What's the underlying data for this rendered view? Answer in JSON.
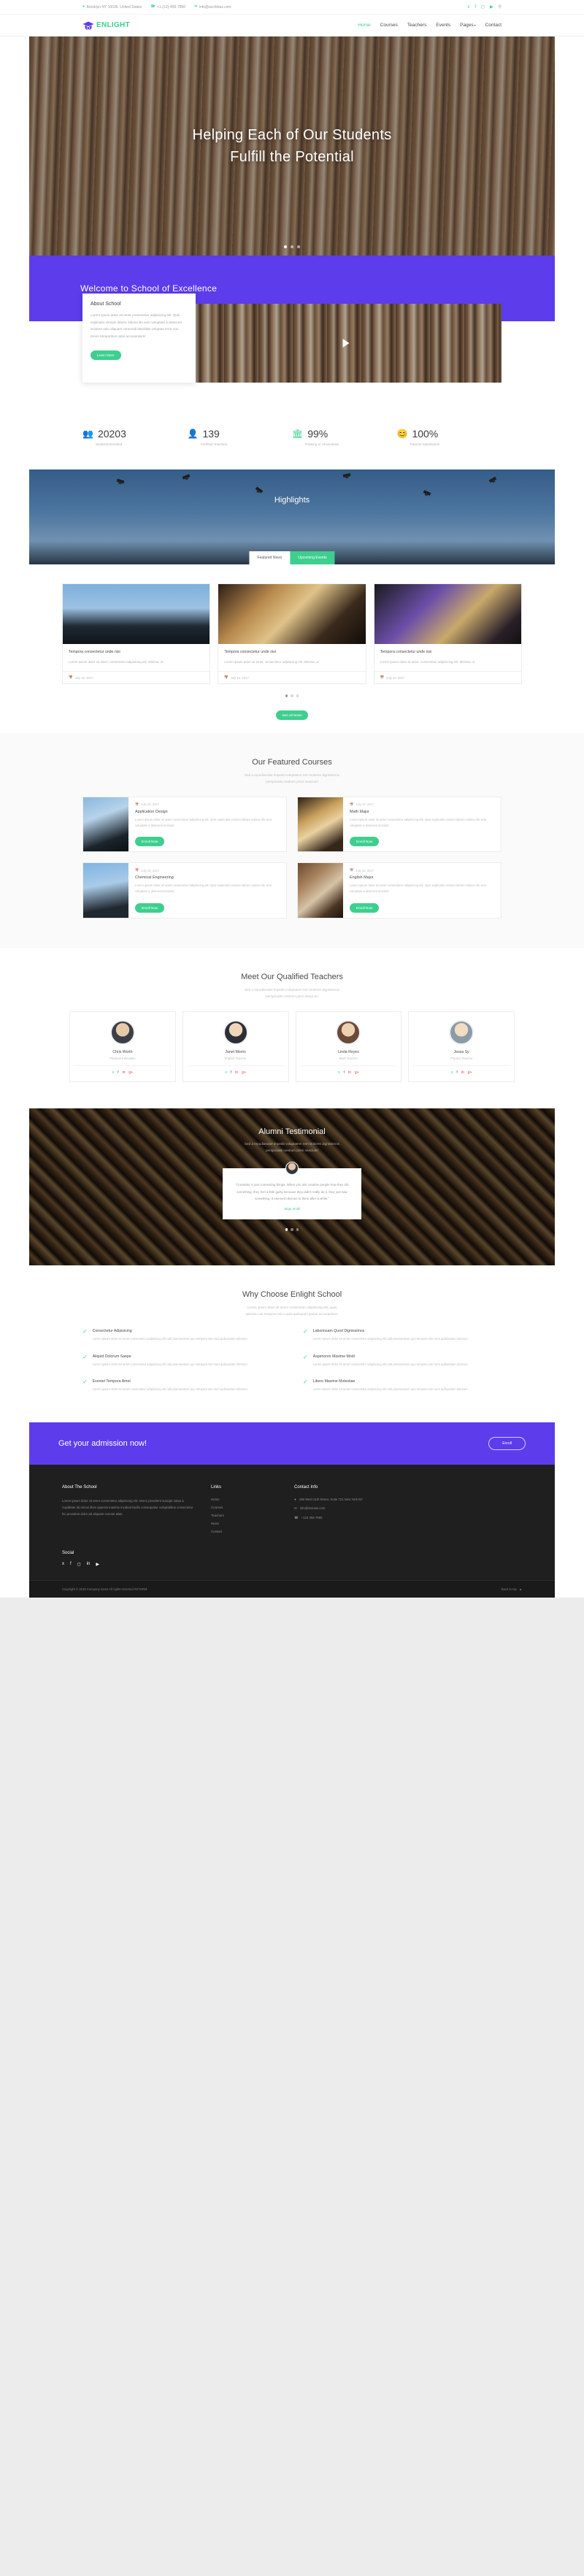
{
  "topbar": {
    "address": "Brooklyn NY 10036, United States",
    "phone": "+1-(12)-456-7890",
    "email": "info@acchinaz.com",
    "location_icon": "map-pin-icon",
    "phone_icon": "phone-icon",
    "email_icon": "envelope-icon",
    "socials": [
      "twitter-icon",
      "facebook-icon",
      "instagram-icon",
      "youtube-icon"
    ],
    "search_icon": "search-icon"
  },
  "brand": {
    "name": "ENLIGHT",
    "icon": "graduation-cap-icon",
    "accent": "#3ecf8e",
    "purple": "#5d3cec"
  },
  "nav": {
    "items": [
      {
        "label": "Home",
        "active": true
      },
      {
        "label": "Courses",
        "active": false
      },
      {
        "label": "Teachers",
        "active": false
      },
      {
        "label": "Events",
        "active": false
      },
      {
        "label": "Pages",
        "active": false,
        "caret": "˅"
      },
      {
        "label": "Contact",
        "active": false
      }
    ]
  },
  "hero": {
    "line1": "Helping Each of Our Students",
    "line2": "Fulfill the Potential",
    "slide_count": 3,
    "active_slide": 1
  },
  "welcome": {
    "title": "Welcome to School of Excellence"
  },
  "about": {
    "title": "About School",
    "body": "Lorem ipsum dolor sit amet consectetur adipisicing elit. Quis explicabo veniam labore ratione illo vero voluptate a deserunt incidunt odio aliquam commodi blanditiis voluptas error non rerum temporibus optio accusantium!",
    "button": "Learn More",
    "video_play_icon": "play-icon"
  },
  "stats": [
    {
      "icon": "students-icon",
      "value": "20203",
      "label": "Students Enrolled"
    },
    {
      "icon": "teacher-icon",
      "value": "139",
      "label": "Certified Teachers"
    },
    {
      "icon": "bank-icon",
      "value": "99%",
      "label": "Passing to Universities"
    },
    {
      "icon": "smile-icon",
      "value": "100%",
      "label": "Parents Satisfaction"
    }
  ],
  "highlights": {
    "title": "Highlights",
    "tabs": [
      {
        "label": "Featured News",
        "active": true
      },
      {
        "label": "Upcoming Events",
        "active": false
      }
    ],
    "cards": [
      {
        "title": "Tempora consectetur unde nisi",
        "desc": "Lorem ipsum dolor sit amet, consectetur adipisicing elit. Minima, ut",
        "date": "July 10, 2017",
        "date_icon": "calendar-icon"
      },
      {
        "title": "Tempora consectetur unde nisi",
        "desc": "Lorem ipsum dolor sit amet, consectetur adipisicing elit. Minima, ut",
        "date": "July 10, 2017",
        "date_icon": "calendar-icon"
      },
      {
        "title": "Tempora consectetur unde nisi",
        "desc": "Lorem ipsum dolor sit amet, consectetur adipisicing elit. Minima, ut",
        "date": "July 10, 2017",
        "date_icon": "calendar-icon"
      }
    ],
    "dots": 3,
    "active_dot": 1,
    "view_all": "See all News"
  },
  "courses": {
    "heading": "Our Featured Courses",
    "sub1": "Sed a repudiandae impedit voluptatem rem Dolores dignissimos",
    "sub2": "perspiciatis nostrum primi nesciunt!",
    "items": [
      {
        "date": "July 10, 2017",
        "date_icon": "calendar-icon",
        "title": "Application Design",
        "desc": "Lorem ipsum dolor sit amet consectetur adipisicing elit. Quis explicabo veniam labore ratione illo vero voluptate a deserunt incidunt.",
        "button": "Enroll Now"
      },
      {
        "date": "July 10, 2017",
        "date_icon": "calendar-icon",
        "title": "Math Major",
        "desc": "Lorem ipsum dolor sit amet consectetur adipisicing elit. Quis explicabo veniam labore ratione illo vero voluptate a deserunt incidunt.",
        "button": "Enroll Now"
      },
      {
        "date": "July 10, 2017",
        "date_icon": "calendar-icon",
        "title": "Chemical Engineering",
        "desc": "Lorem ipsum dolor sit amet consectetur adipisicing elit. Quis explicabo veniam labore ratione illo vero voluptate a deserunt incidunt.",
        "button": "Enroll Now"
      },
      {
        "date": "July 10, 2017",
        "date_icon": "calendar-icon",
        "title": "English Major",
        "desc": "Lorem ipsum dolor sit amet consectetur adipisicing elit. Quis explicabo veniam labore ratione illo vero voluptate a deserunt incidunt.",
        "button": "Enroll Now"
      }
    ]
  },
  "teachers": {
    "heading": "Meet Our Qualified Teachers",
    "sub1": "Sed a repudiandae impedit voluptatem rem Dolores dignissimos",
    "sub2": "perspiciatis nostrum primi nesciunt!",
    "items": [
      {
        "name": "Chris Worth",
        "role": "Physical Education",
        "socials": [
          "twitter-icon",
          "facebook-icon",
          "linkedin-icon",
          "google-plus-icon"
        ]
      },
      {
        "name": "Janet Morris",
        "role": "English Teacher",
        "socials": [
          "twitter-icon",
          "facebook-icon",
          "linkedin-icon",
          "google-plus-icon"
        ]
      },
      {
        "name": "Linda Reyes",
        "role": "Math Teacher",
        "socials": [
          "twitter-icon",
          "facebook-icon",
          "linkedin-icon",
          "google-plus-icon"
        ]
      },
      {
        "name": "Jessa Sy",
        "role": "Physics Teacher",
        "socials": [
          "twitter-icon",
          "facebook-icon",
          "linkedin-icon",
          "google-plus-icon"
        ]
      }
    ]
  },
  "testimonial": {
    "heading": "Alumni Testimonial",
    "sub1": "Sed a repudiandae impedit voluptatem rem Dolores dignissimos",
    "sub2": "perspiciatis nostrum primi nesciunt!",
    "quote": "\"Creativity is just connecting things. When you ask creative people how they did something, they feel a little guilty because they didn't really do it, they just saw something. It seemed obvious to them after a while.\"",
    "author": "Jorge Smith",
    "dots": 3,
    "active_dot": 1
  },
  "why": {
    "heading": "Why Choose Enlight School",
    "sub1": "Lorem ipsum dolor sit amet consectetur adipisicing elit, quas",
    "sub2": "aperiam aut tempore nisi a quia quisquam ipsum accusantium.",
    "items": [
      {
        "title": "Consectetur Adipisicing",
        "desc": "Lorem ipsum dolor sit amet consectetur adipisicing elit odit praesentium quo tempore iste sunt quibusdam dolorum."
      },
      {
        "title": "Laboriosam Quod Dignissimos",
        "desc": "Lorem ipsum dolor sit amet consectetur adipisicing elit odit praesentium quo tempore iste sunt quibusdam dolorum."
      },
      {
        "title": "Aliquid Dolorum Saepe",
        "desc": "Lorem ipsum dolor sit amet consectetur adipisicing elit odit praesentium quo tempore iste sunt quibusdam dolorum."
      },
      {
        "title": "Asperiores Maxime Modi",
        "desc": "Lorem ipsum dolor sit amet consectetur adipisicing elit odit praesentium quo tempore iste sunt quibusdam dolorum."
      },
      {
        "title": "Eveniet Tempora Amet",
        "desc": "Lorem ipsum dolor sit amet consectetur adipisicing elit odit praesentium quo tempore iste sunt quibusdam dolorum."
      },
      {
        "title": "Libero Maxime Molestiae",
        "desc": "Lorem ipsum dolor sit amet consectetur adipisicing elit odit praesentium quo tempore iste sunt quibusdam dolorum."
      }
    ]
  },
  "cta": {
    "title": "Get your admission now!",
    "button": "Enroll"
  },
  "footer": {
    "about_title": "About The School",
    "about_body": "Lorem ipsum dolor sit amet consectetur adipisicing elit. Nemo provident suscipit natus a cupiditate ab minus illum quaerat maxime incidunt facilis consequatur voluptatibus consectetur hic provident dolor ab aliquam eveniet alias.",
    "links_title": "Links",
    "links": [
      "Home",
      "Courses",
      "Teachers",
      "News",
      "Contact"
    ],
    "contact_title": "Contact Info",
    "contact": [
      {
        "icon": "map-pin-icon",
        "text": "198 West 21th Street, Suite 721 New York NY"
      },
      {
        "icon": "envelope-icon",
        "text": "info@domain.com"
      },
      {
        "icon": "phone-icon",
        "text": "+123 456 7890"
      }
    ],
    "social_title": "Social",
    "socials": [
      "twitter-icon",
      "facebook-icon",
      "instagram-icon",
      "linkedin-icon",
      "youtube-icon"
    ],
    "copyright": "Copyright © 2018 Company name All rights reserved #STORM",
    "back_to_top": "Back to top",
    "back_to_top_icon": "chevron-up-icon"
  }
}
